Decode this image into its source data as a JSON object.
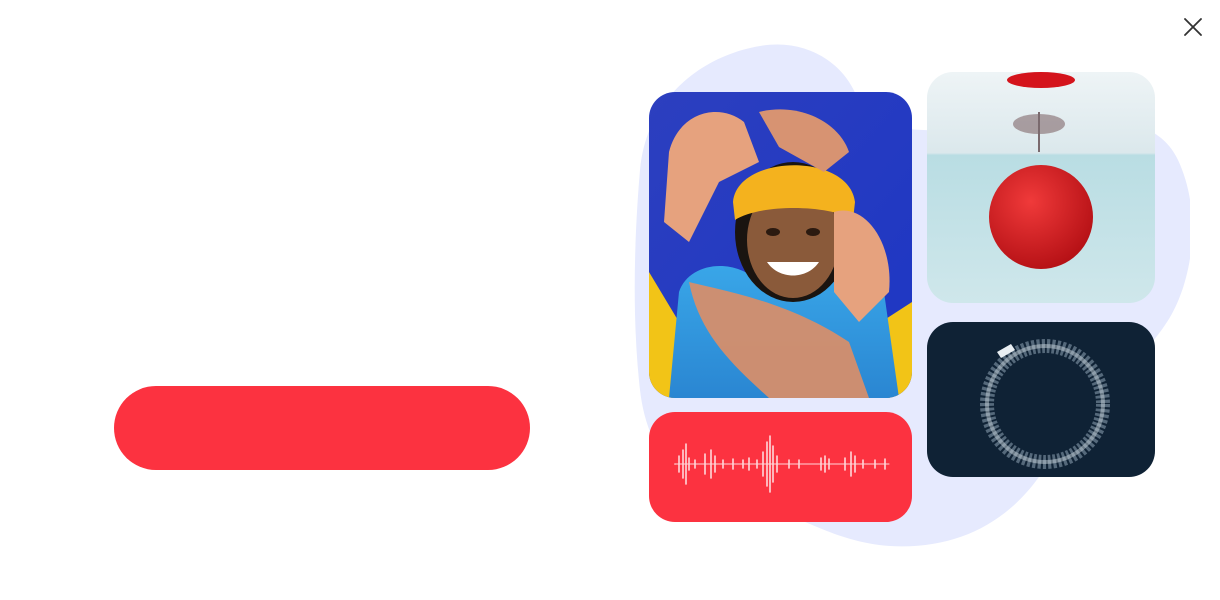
{
  "dialog": {
    "close_icon": "close-icon",
    "cta_label": ""
  },
  "illustration": {
    "blob_color": "#e6eafe",
    "tiles": [
      {
        "name": "woman-photo",
        "description_icon": "photo"
      },
      {
        "name": "red-ball-photo",
        "description_icon": "photo"
      },
      {
        "name": "boat-wake-photo",
        "description_icon": "photo"
      },
      {
        "name": "audio-waveform-tile",
        "description_icon": "waveform-icon"
      }
    ]
  },
  "colors": {
    "accent": "#fc3240",
    "background": "#ffffff",
    "blob": "#e6eafe"
  }
}
